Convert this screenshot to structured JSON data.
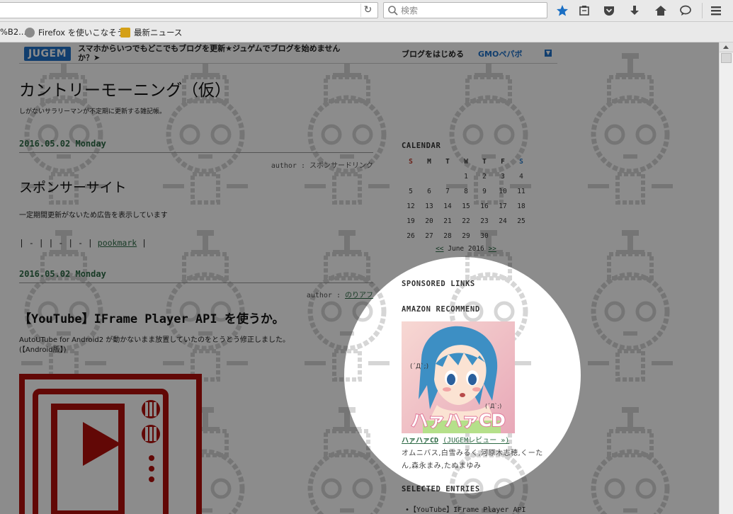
{
  "browser": {
    "url_value": "",
    "search_placeholder": "検索",
    "bookmarks": [
      "%B2...",
      "Firefox を使いこなそう",
      "最新ニュース"
    ]
  },
  "jugem_bar": {
    "logo": "JUGEM",
    "promo": "スマホからいつでもどこでもブログを更新★ジュゲムでブログを始めませんか？➤",
    "start": "ブログをはじめる",
    "gmo": "GMOペパボ"
  },
  "blog": {
    "title": "カントリーモーニング（仮）",
    "description": "しがないサラリーマンが不定期に更新する雑記帳。"
  },
  "entries": [
    {
      "date": "2016.05.02 Monday",
      "author_prefix": "author : ",
      "author": "スポンサードリンク",
      "title": "スポンサーサイト",
      "body": "一定期間更新がないため広告を表示しています",
      "links_prefix": "| - | | - | - | ",
      "links_bookmark": "pookmark",
      "links_suffix": " |"
    },
    {
      "date": "2016.05.02 Monday",
      "author_prefix": "author : ",
      "author": "のりアフ",
      "title": "【YouTube】IFrame Player API を使うか。",
      "body_line1": "AutoUTube for Android2 が動かないまま放置していたのをとうとう修正しました。",
      "body_line2": "(【Android版】)"
    }
  ],
  "sidebar": {
    "calendar_heading": "CALENDAR",
    "calendar_days": [
      "S",
      "M",
      "T",
      "W",
      "T",
      "F",
      "S"
    ],
    "calendar_cells": [
      "",
      "",
      "",
      "1",
      "2",
      "3",
      "4",
      "5",
      "6",
      "7",
      "8",
      "9",
      "10",
      "11",
      "12",
      "13",
      "14",
      "15",
      "16",
      "17",
      "18",
      "19",
      "20",
      "21",
      "22",
      "23",
      "24",
      "25",
      "26",
      "27",
      "28",
      "29",
      "30",
      "",
      ""
    ],
    "calendar_prev": "<<",
    "calendar_month": " June 2016 ",
    "calendar_next": ">>",
    "sponsored_heading": "SPONSORED LINKS",
    "amazon_heading": "AMAZON RECOMMEND",
    "amazon_image_text": "ハァハァCD",
    "amazon_title": "ハァハァCD",
    "amazon_review": "(JUGEMレビュー »)",
    "amazon_credit": "オムニバス,白雪みるく,河原木志穂,くーたん,森永まみ,たぬまゆみ",
    "selected_heading": "SELECTED ENTRIES",
    "selected_item": "•【YouTube】IFrame Player API"
  },
  "colors": {
    "accent_green": "#2d6a45",
    "youtube_red": "#b3100b",
    "jugem_blue": "#1f72c8",
    "firefox_star": "#1a6fc4"
  }
}
